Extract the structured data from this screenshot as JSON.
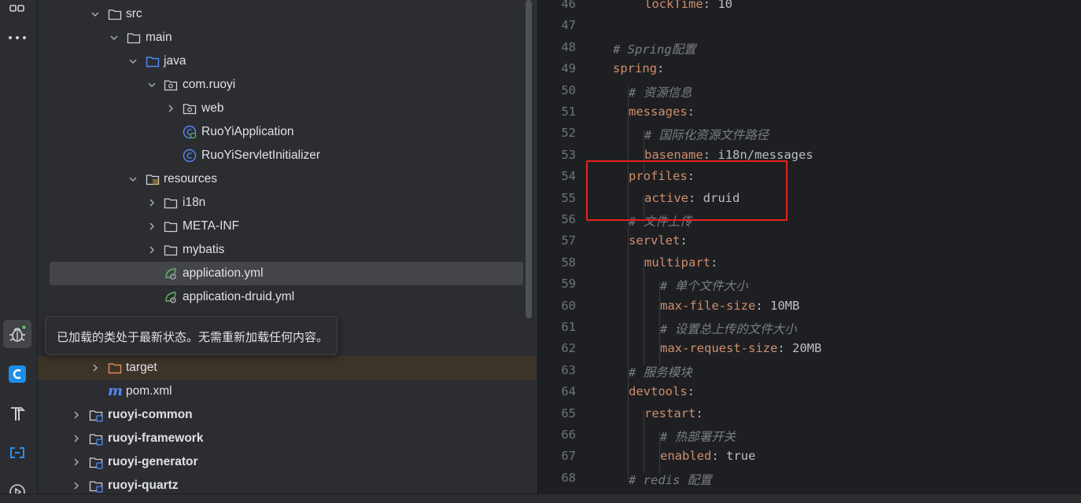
{
  "tree": {
    "items": [
      {
        "label": "src",
        "type": "folder"
      },
      {
        "label": "main",
        "type": "folder"
      },
      {
        "label": "java",
        "type": "source-folder"
      },
      {
        "label": "com.ruoyi",
        "type": "package"
      },
      {
        "label": "web",
        "type": "package"
      },
      {
        "label": "RuoYiApplication",
        "type": "spring-class"
      },
      {
        "label": "RuoYiServletInitializer",
        "type": "class"
      },
      {
        "label": "resources",
        "type": "resources-folder"
      },
      {
        "label": "i18n",
        "type": "folder"
      },
      {
        "label": "META-INF",
        "type": "folder"
      },
      {
        "label": "mybatis",
        "type": "folder"
      },
      {
        "label": "application.yml",
        "type": "yaml-file"
      },
      {
        "label": "application-druid.yml",
        "type": "yaml-file"
      },
      {
        "label": "target",
        "type": "excluded-folder"
      },
      {
        "label": "pom.xml",
        "type": "maven-file"
      },
      {
        "label": "ruoyi-common",
        "type": "module"
      },
      {
        "label": "ruoyi-framework",
        "type": "module"
      },
      {
        "label": "ruoyi-generator",
        "type": "module"
      },
      {
        "label": "ruoyi-quartz",
        "type": "module"
      }
    ]
  },
  "tooltip": {
    "text": "已加载的类处于最新状态。无需重新加载任何内容。"
  },
  "editor": {
    "lines": [
      {
        "num": "46",
        "key": "lockTime",
        "value": "10"
      },
      {
        "num": "47"
      },
      {
        "num": "48",
        "comment": "# Spring配置"
      },
      {
        "num": "49",
        "key": "spring"
      },
      {
        "num": "50",
        "comment": "# 资源信息"
      },
      {
        "num": "51",
        "key": "messages"
      },
      {
        "num": "52",
        "comment": "# 国际化资源文件路径"
      },
      {
        "num": "53",
        "key": "basename",
        "value": "i18n/messages"
      },
      {
        "num": "54",
        "key": "profiles"
      },
      {
        "num": "55",
        "key": "active",
        "value": "druid"
      },
      {
        "num": "56",
        "comment": "# 文件上传"
      },
      {
        "num": "57",
        "key": "servlet"
      },
      {
        "num": "58",
        "key": "multipart"
      },
      {
        "num": "59",
        "comment": "# 单个文件大小"
      },
      {
        "num": "60",
        "key": "max-file-size",
        "value": "10MB"
      },
      {
        "num": "61",
        "comment": "# 设置总上传的文件大小"
      },
      {
        "num": "62",
        "key": "max-request-size",
        "value": "20MB"
      },
      {
        "num": "63",
        "comment": "# 服务模块"
      },
      {
        "num": "64",
        "key": "devtools"
      },
      {
        "num": "65",
        "key": "restart"
      },
      {
        "num": "66",
        "comment": "# 热部署开关"
      },
      {
        "num": "67",
        "key": "enabled",
        "value": "true"
      },
      {
        "num": "68",
        "comment": "# redis 配置"
      }
    ]
  },
  "colors": {
    "highlight_box": "#e8221b",
    "yaml_key": "#cf8e6d",
    "comment": "#7a7e85"
  },
  "icons": [
    "project-view-icon",
    "more-icon",
    "debug-icon",
    "codegeex-icon",
    "build-icon",
    "remote-icon",
    "run-icon"
  ]
}
